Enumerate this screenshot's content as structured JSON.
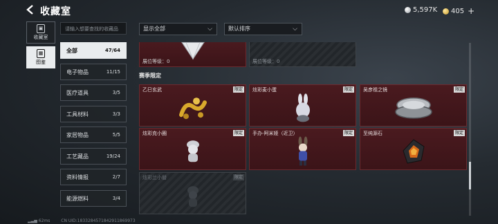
{
  "header": {
    "back_icon": "back-arrow-icon",
    "title": "收藏室",
    "currency": [
      {
        "icon": "silver-coin-icon",
        "value": "5,597K"
      },
      {
        "icon": "gold-coin-icon",
        "value": "405"
      }
    ],
    "plus": "+"
  },
  "left_nav": [
    {
      "label": "收藏室",
      "icon": "room-icon",
      "active": false
    },
    {
      "label": "图鉴",
      "icon": "catalog-icon",
      "active": true
    }
  ],
  "search": {
    "placeholder": "请输入想要查找的收藏品"
  },
  "categories": [
    {
      "name": "全部",
      "count": "47/64",
      "active": true
    },
    {
      "name": "电子物品",
      "count": "11/15",
      "active": false
    },
    {
      "name": "医疗道具",
      "count": "3/5",
      "active": false
    },
    {
      "name": "工具材料",
      "count": "3/3",
      "active": false
    },
    {
      "name": "家居物品",
      "count": "5/5",
      "active": false
    },
    {
      "name": "工艺藏品",
      "count": "19/24",
      "active": false
    },
    {
      "name": "资料情报",
      "count": "2/7",
      "active": false
    },
    {
      "name": "能源燃料",
      "count": "3/4",
      "active": false
    }
  ],
  "filters": {
    "show": {
      "label": "显示全部"
    },
    "sort": {
      "label": "默认排序"
    }
  },
  "top_row": [
    {
      "level_label": "展位等级：0",
      "collected": true
    },
    {
      "level_label": "展位等级：0",
      "collected": false
    }
  ],
  "section_title": "赛季限定",
  "items": [
    {
      "name": "乙巳玄武",
      "tag": "限定",
      "collected": true,
      "art": "dragon"
    },
    {
      "name": "炫彩麦小蛋",
      "tag": "限定",
      "collected": true,
      "art": "bunny"
    },
    {
      "name": "吴彦祖之镜",
      "tag": "限定",
      "collected": true,
      "art": "mirror"
    },
    {
      "name": "炫彩克小圈",
      "tag": "限定",
      "collected": true,
      "art": "figure"
    },
    {
      "name": "手办-阿米娅（近卫）",
      "tag": "限定",
      "collected": true,
      "art": "amiya"
    },
    {
      "name": "至纯源石",
      "tag": "限定",
      "collected": true,
      "art": "crystal"
    },
    {
      "name": "炫彩兰小替",
      "tag": "限定",
      "collected": false,
      "art": "ghost"
    }
  ],
  "scroll": {
    "position": 0.82
  },
  "footer": {
    "ping": "62ms",
    "uid": "CN UID:1833284571842911869973"
  }
}
